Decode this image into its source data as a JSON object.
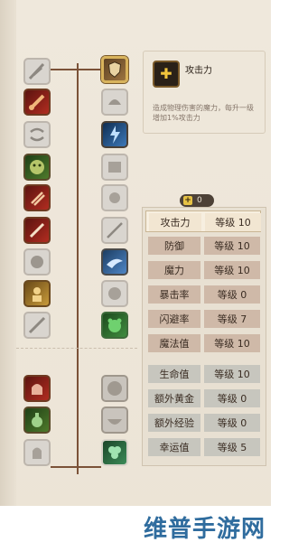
{
  "detail": {
    "title": "攻击力",
    "description": "造成物理伤害的魔力，每升一级增加1%攻击力"
  },
  "points": {
    "value": "0"
  },
  "stats": [
    {
      "name": "攻击力",
      "level": "等级 10"
    },
    {
      "name": "防御",
      "level": "等级 10"
    },
    {
      "name": "魔力",
      "level": "等级 10"
    },
    {
      "name": "暴击率",
      "level": "等级 0"
    },
    {
      "name": "闪避率",
      "level": "等级 7"
    },
    {
      "name": "魔法值",
      "level": "等级 10"
    },
    {
      "name": "生命值",
      "level": "等级 10"
    },
    {
      "name": "额外黄金",
      "level": "等级 0"
    },
    {
      "name": "额外经验",
      "level": "等级 0"
    },
    {
      "name": "幸运值",
      "level": "等级 5"
    }
  ],
  "watermark": "维普手游网",
  "colors": {
    "accent": "#d8b35c",
    "plus": "#f1c43c",
    "watermark": "#2f6c9e"
  }
}
